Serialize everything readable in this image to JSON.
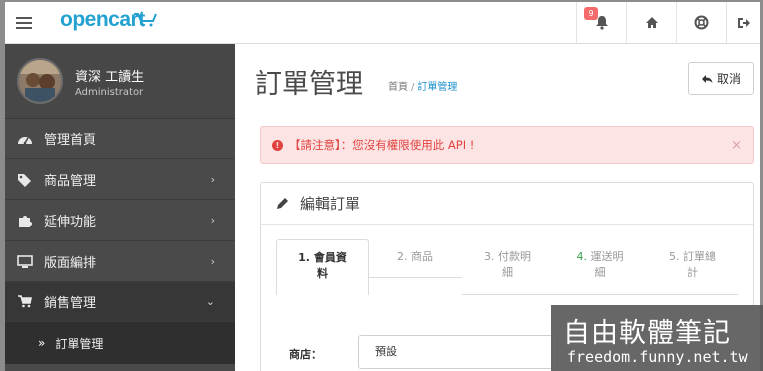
{
  "header": {
    "logo_text": "opencart",
    "alert_count": "9",
    "icons": [
      "menu-toggle-icon",
      "bell-icon",
      "home-icon",
      "life-ring-icon",
      "sign-out-icon"
    ],
    "brand_color": "#23a1d1"
  },
  "sidebar": {
    "user_name": "資深 工讀生",
    "user_role": "Administrator",
    "items": [
      {
        "label": "管理首頁",
        "icon": "dashboard-icon"
      },
      {
        "label": "商品管理",
        "icon": "tags-icon"
      },
      {
        "label": "延伸功能",
        "icon": "puzzle-icon"
      },
      {
        "label": "版面編排",
        "icon": "desktop-icon"
      },
      {
        "label": "銷售管理",
        "icon": "cart-icon"
      },
      {
        "label": "訂單管理",
        "icon": "double-chevron-icon"
      }
    ]
  },
  "page": {
    "title": "訂單管理",
    "breadcrumb": [
      "首頁",
      "訂單管理"
    ],
    "cancel_label": "取消",
    "alert_text": "【請注意】：您沒有權限使用此 API !",
    "alert_close": "×",
    "alert_color": "#e0433f",
    "panel_title": "編輯訂單",
    "tabs": [
      {
        "num": "1.",
        "label": "會員資",
        "label2": "料"
      },
      {
        "num": "2.",
        "label": "商品",
        "label2": ""
      },
      {
        "num": "3.",
        "label": "付款明",
        "label2": "細"
      },
      {
        "num": "4.",
        "label": "運送明",
        "label2": "細"
      },
      {
        "num": "5.",
        "label": "訂單總",
        "label2": "計"
      }
    ],
    "store_label": "商店：",
    "store_value": "預設"
  },
  "watermark": {
    "title": "自由軟體筆記",
    "url": "freedom.funny.net.tw"
  }
}
